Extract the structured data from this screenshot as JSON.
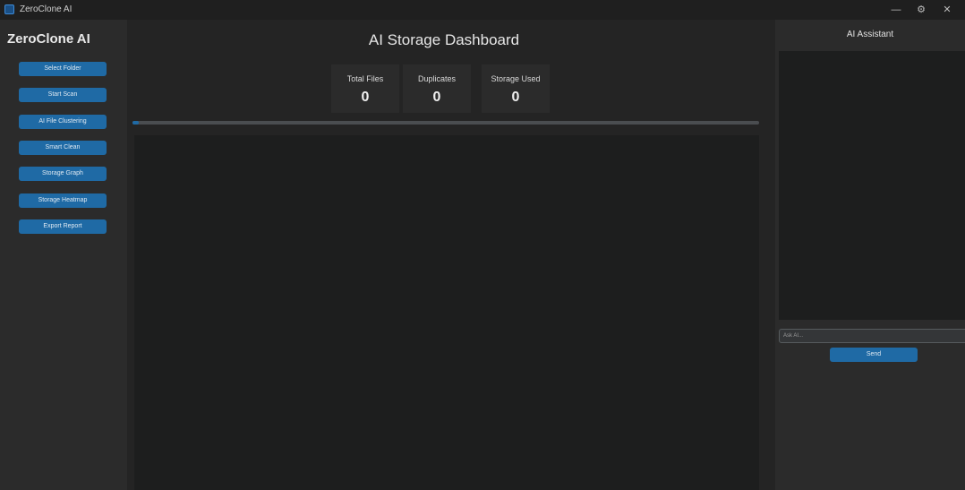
{
  "window": {
    "title": "ZeroClone AI",
    "minimize_glyph": "—",
    "maximize_glyph": "⚙",
    "close_glyph": "✕"
  },
  "sidebar": {
    "app_name": "ZeroClone AI",
    "buttons": [
      {
        "label": "Select Folder"
      },
      {
        "label": "Start Scan"
      },
      {
        "label": "AI File Clustering"
      },
      {
        "label": "Smart Clean"
      },
      {
        "label": "Storage Graph"
      },
      {
        "label": "Storage Heatmap"
      },
      {
        "label": "Export Report"
      }
    ]
  },
  "main": {
    "title": "AI Storage Dashboard",
    "stats": [
      {
        "label": "Total Files",
        "value": "0"
      },
      {
        "label": "Duplicates",
        "value": "0"
      },
      {
        "label": "Storage Used",
        "value": "0"
      }
    ],
    "progress": 0.01
  },
  "assistant": {
    "title": "AI Assistant",
    "input_placeholder": "Ask AI...",
    "send_label": "Send"
  },
  "colors": {
    "accent": "#1f6aa5",
    "background": "#242424",
    "panel": "#2b2b2b",
    "content": "#1d1e1e"
  }
}
